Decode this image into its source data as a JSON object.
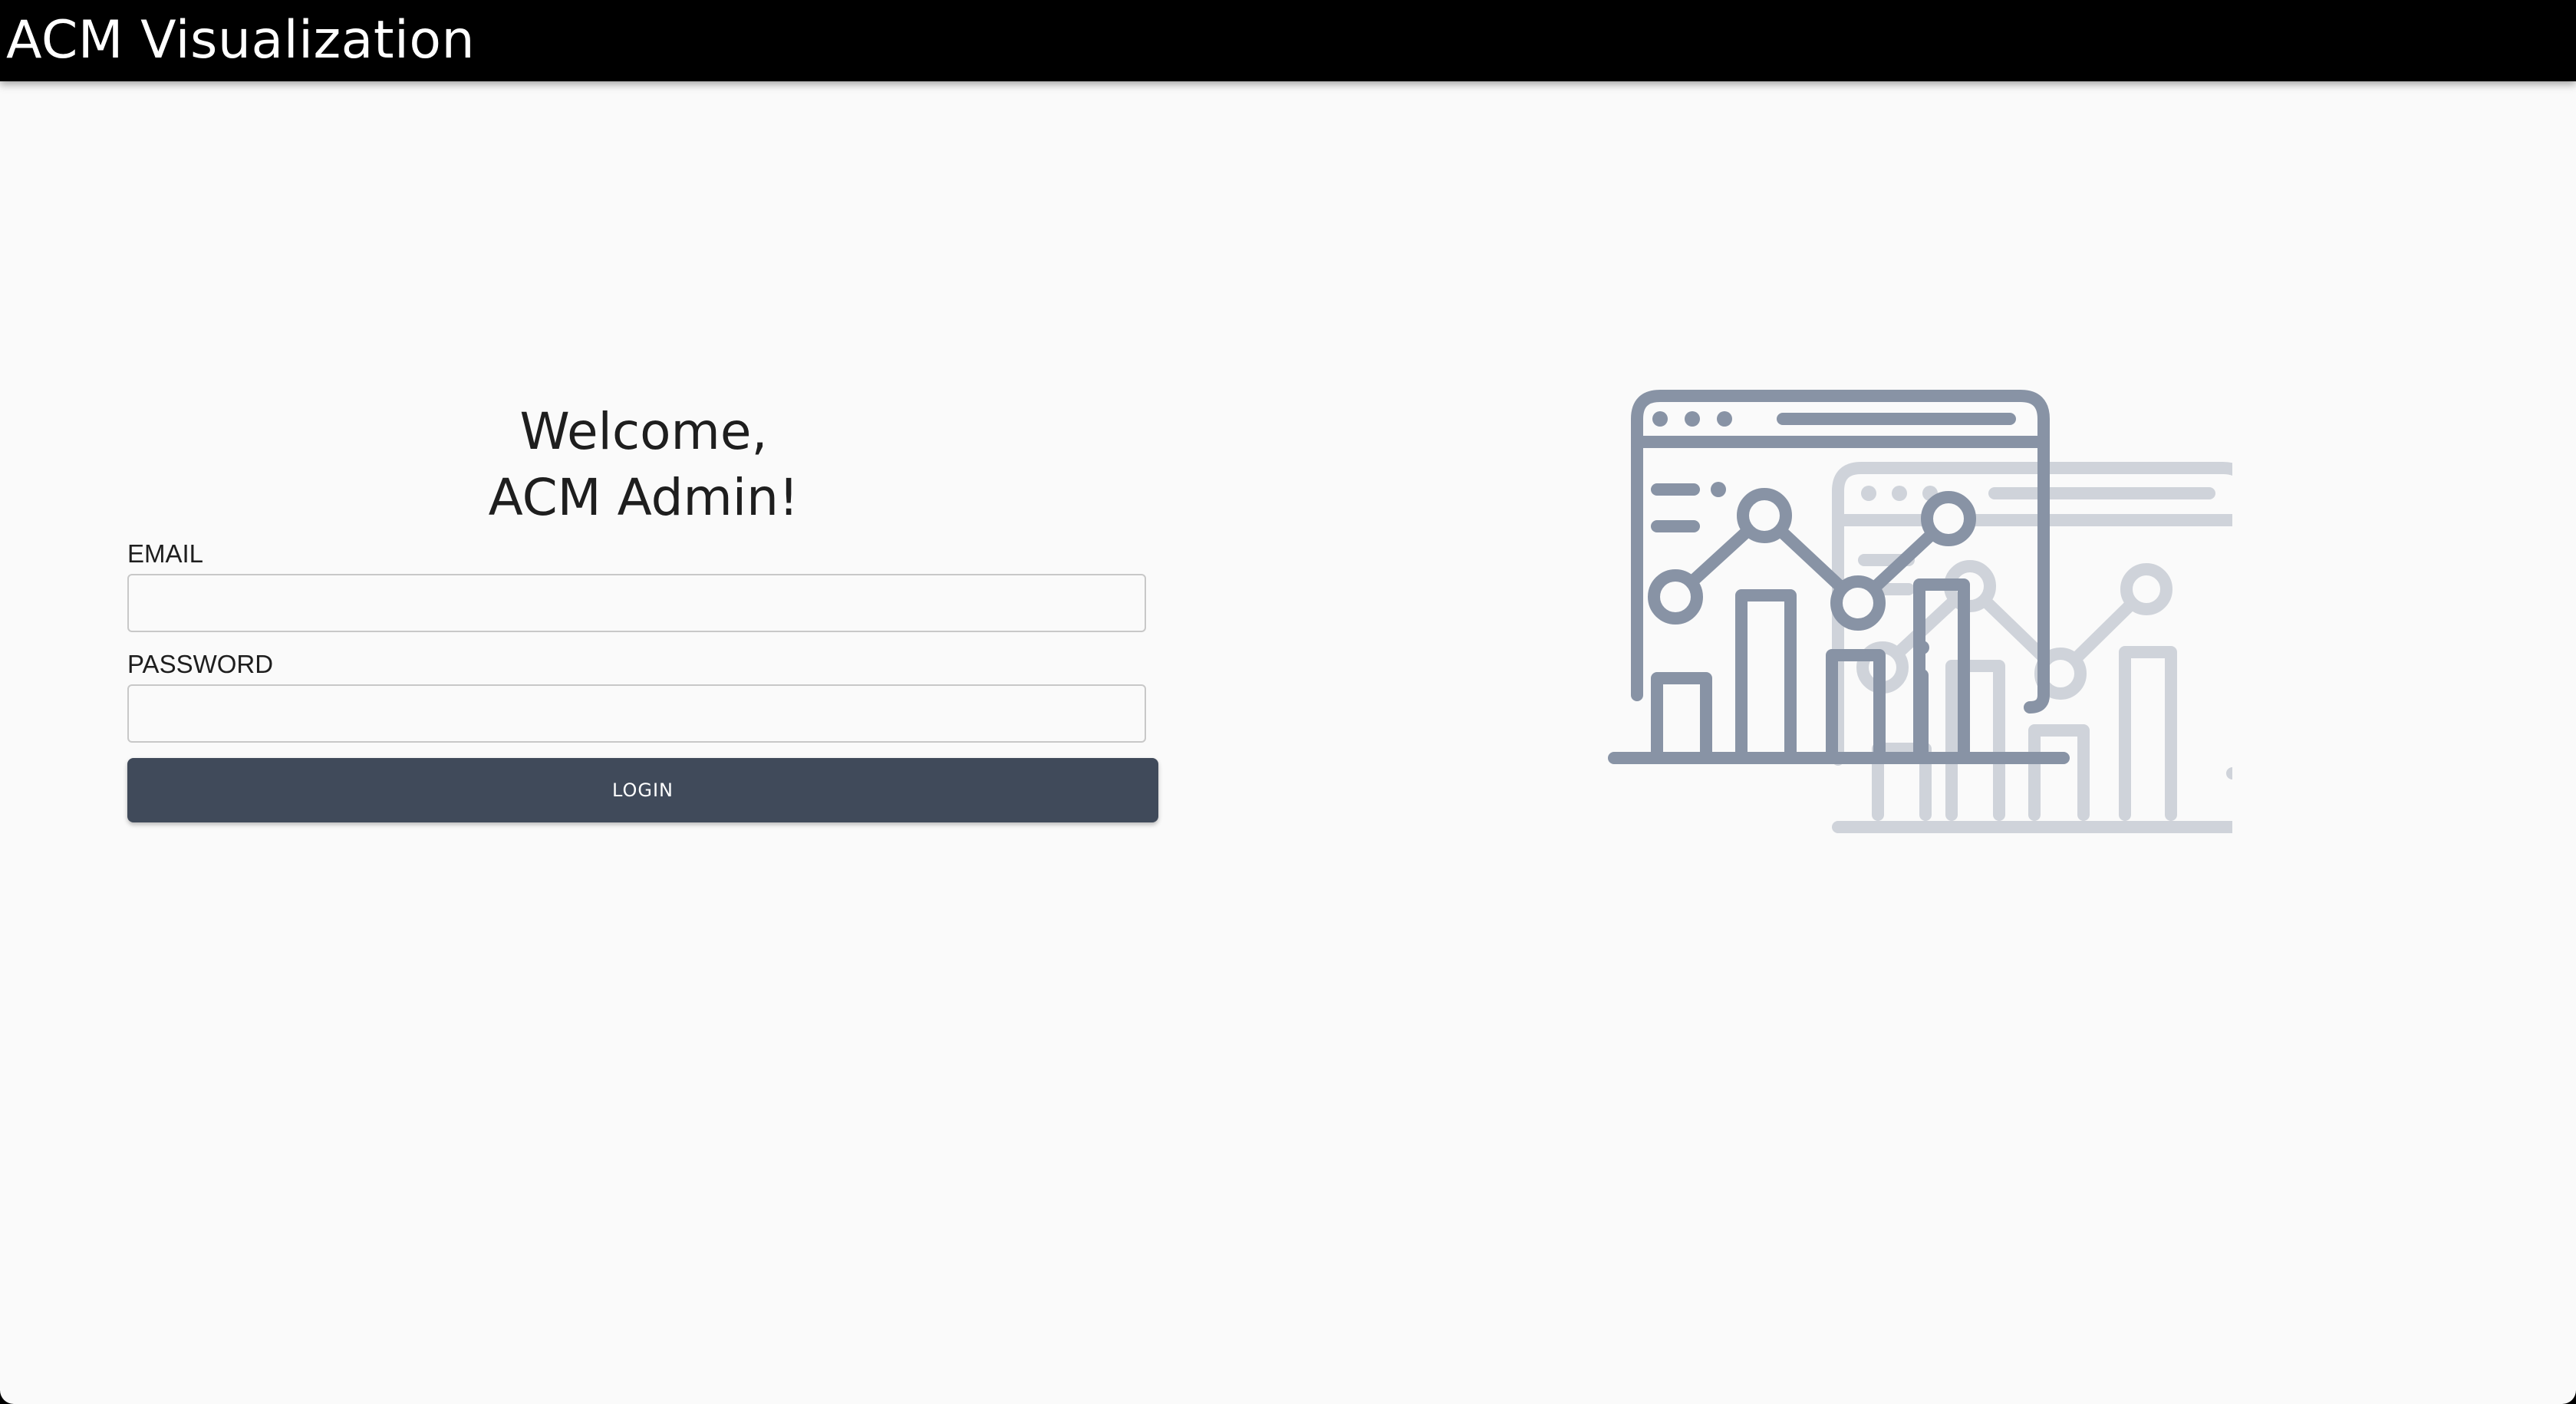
{
  "header": {
    "title": "ACM Visualization"
  },
  "login": {
    "welcome_line1": "Welcome,",
    "welcome_line2": "ACM Admin!",
    "email_label": "EMAIL",
    "email_value": "",
    "password_label": "PASSWORD",
    "password_value": "",
    "login_button_label": "LOGIN"
  },
  "illustration": {
    "icon": "analytics-dashboard-icon",
    "front_color": "#8893a5",
    "back_color": "#cfd3da"
  },
  "colors": {
    "header_background": "#000000",
    "page_background": "#fafafa",
    "button_background": "#404a5a",
    "button_text": "#ffffff"
  }
}
